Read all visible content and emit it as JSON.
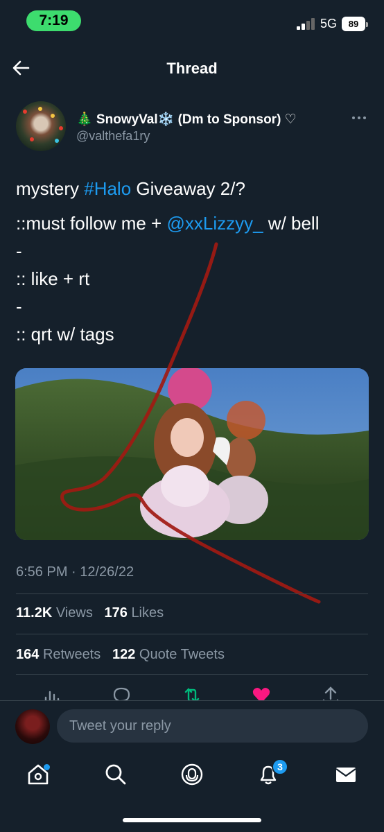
{
  "status_bar": {
    "time": "7:19",
    "network": "5G",
    "battery": "89"
  },
  "header": {
    "title": "Thread"
  },
  "tweet": {
    "author_name": "🎄 SnowyVal❄️ (Dm to Sponsor) ♡",
    "author_handle": "@valthefa1ry",
    "text": {
      "line1_pre": "mystery ",
      "line1_tag": "#Halo",
      "line1_post": " Giveaway 2/?",
      "line2_pre": "::must follow me + ",
      "line2_mention": "@xxLizzyy_",
      "line2_post": " w/ bell",
      "line3": "-",
      "line4": ":: like + rt",
      "line5": "-",
      "line6": ":: qrt w/ tags"
    },
    "timestamp": "6:56 PM · 12/26/22",
    "stats": {
      "views_count": "11.2K",
      "views_label": "Views",
      "likes_count": "176",
      "likes_label": "Likes",
      "retweets_count": "164",
      "retweets_label": "Retweets",
      "quotes_count": "122",
      "quotes_label": "Quote Tweets"
    }
  },
  "reply": {
    "placeholder": "Tweet your reply"
  },
  "nav": {
    "notifications_badge": "3"
  },
  "colors": {
    "background": "#15202b",
    "link": "#1d9bf0",
    "muted": "#8b98a5",
    "retweet_active": "#00ba7c",
    "like_active": "#f91880",
    "scribble": "#a11a12"
  },
  "icons": [
    "back-arrow-icon",
    "more-icon",
    "views-icon",
    "reply-icon",
    "retweet-icon",
    "like-icon",
    "share-icon",
    "home-icon",
    "search-icon",
    "spaces-icon",
    "notifications-icon",
    "messages-icon"
  ]
}
